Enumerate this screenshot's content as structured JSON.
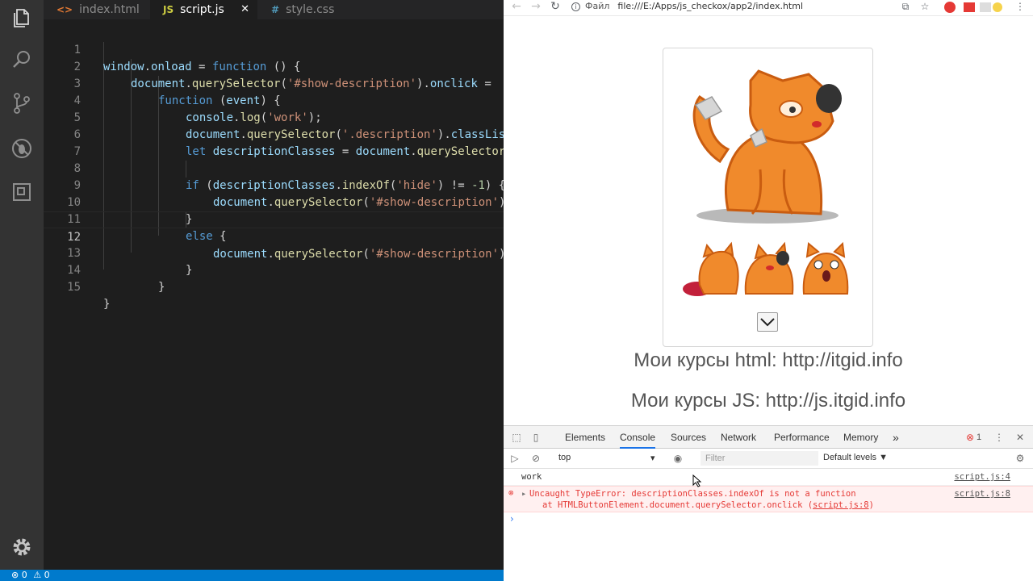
{
  "vscode": {
    "tabs": [
      {
        "label": "index.html",
        "icon": "<>",
        "active": false
      },
      {
        "label": "script.js",
        "icon": "JS",
        "active": true,
        "close": "✕"
      },
      {
        "label": "style.css",
        "icon": "#",
        "active": false
      }
    ],
    "line_numbers": [
      "1",
      "2",
      "3",
      "4",
      "5",
      "6",
      "7",
      "8",
      "9",
      "10",
      "11",
      "12",
      "13",
      "14",
      "15"
    ],
    "code": {
      "l1": {
        "a": "window",
        "b": ".",
        "c": "onload",
        "d": " = ",
        "e": "function",
        "f": " () {"
      },
      "l2": {
        "a": "document",
        "b": ".",
        "c": "querySelector",
        "d": "(",
        "e": "'#show-description'",
        "f": ").",
        "g": "onclick",
        "h": " ="
      },
      "l3": {
        "a": "function",
        "b": " (",
        "c": "event",
        "d": ") {"
      },
      "l4": {
        "a": "console",
        "b": ".",
        "c": "log",
        "d": "(",
        "e": "'work'",
        "f": ");"
      },
      "l5": {
        "a": "document",
        "b": ".",
        "c": "querySelector",
        "d": "(",
        "e": "'.description'",
        "f": ").",
        "g": "classLis"
      },
      "l6": {
        "a": "let",
        "b": " ",
        "c": "descriptionClasses",
        "d": " = ",
        "e": "document",
        "f": ".",
        "g": "querySelector"
      },
      "l8": {
        "a": "if",
        "b": " (",
        "c": "descriptionClasses",
        "d": ".",
        "e": "indexOf",
        "f": "(",
        "g": "'hide'",
        "h": ") != ",
        "i": "-1",
        "j": ") {"
      },
      "l9": {
        "a": "document",
        "b": ".",
        "c": "querySelector",
        "d": "(",
        "e": "'#show-description'",
        "f": ")"
      },
      "l10": "}",
      "l11": {
        "a": "else",
        "b": " {"
      },
      "l12": {
        "a": "document",
        "b": ".",
        "c": "querySelector",
        "d": "(",
        "e": "'#show-description'",
        "f": ")"
      },
      "l13": "}",
      "l14": "}",
      "l15": "}"
    },
    "status": {
      "errors": "0",
      "warnings": "0"
    }
  },
  "browser": {
    "address_label": "Файл",
    "url": "file:///E:/Apps/js_checkox/app2/index.html",
    "page": {
      "course_html": "Мои курсы html: http://itgid.info",
      "course_js": "Мои курсы JS: http://js.itgid.info"
    }
  },
  "devtools": {
    "tabs": [
      "Elements",
      "Console",
      "Sources",
      "Network",
      "Performance",
      "Memory"
    ],
    "more": "»",
    "error_count": "1",
    "context": "top",
    "filter_placeholder": "Filter",
    "levels": "Default levels ▼",
    "messages": {
      "log_text": "work",
      "log_src": "script.js:4",
      "err_line1": "Uncaught TypeError: descriptionClasses.indexOf is not a function",
      "err_line2": "at HTMLButtonElement.document.querySelector.onclick (",
      "err_link": "script.js:8",
      "err_close": ")",
      "err_src": "script.js:8"
    }
  },
  "colors": {
    "accent": "#007acc",
    "error": "#e53935",
    "cat_orange": "#f08a2c"
  }
}
